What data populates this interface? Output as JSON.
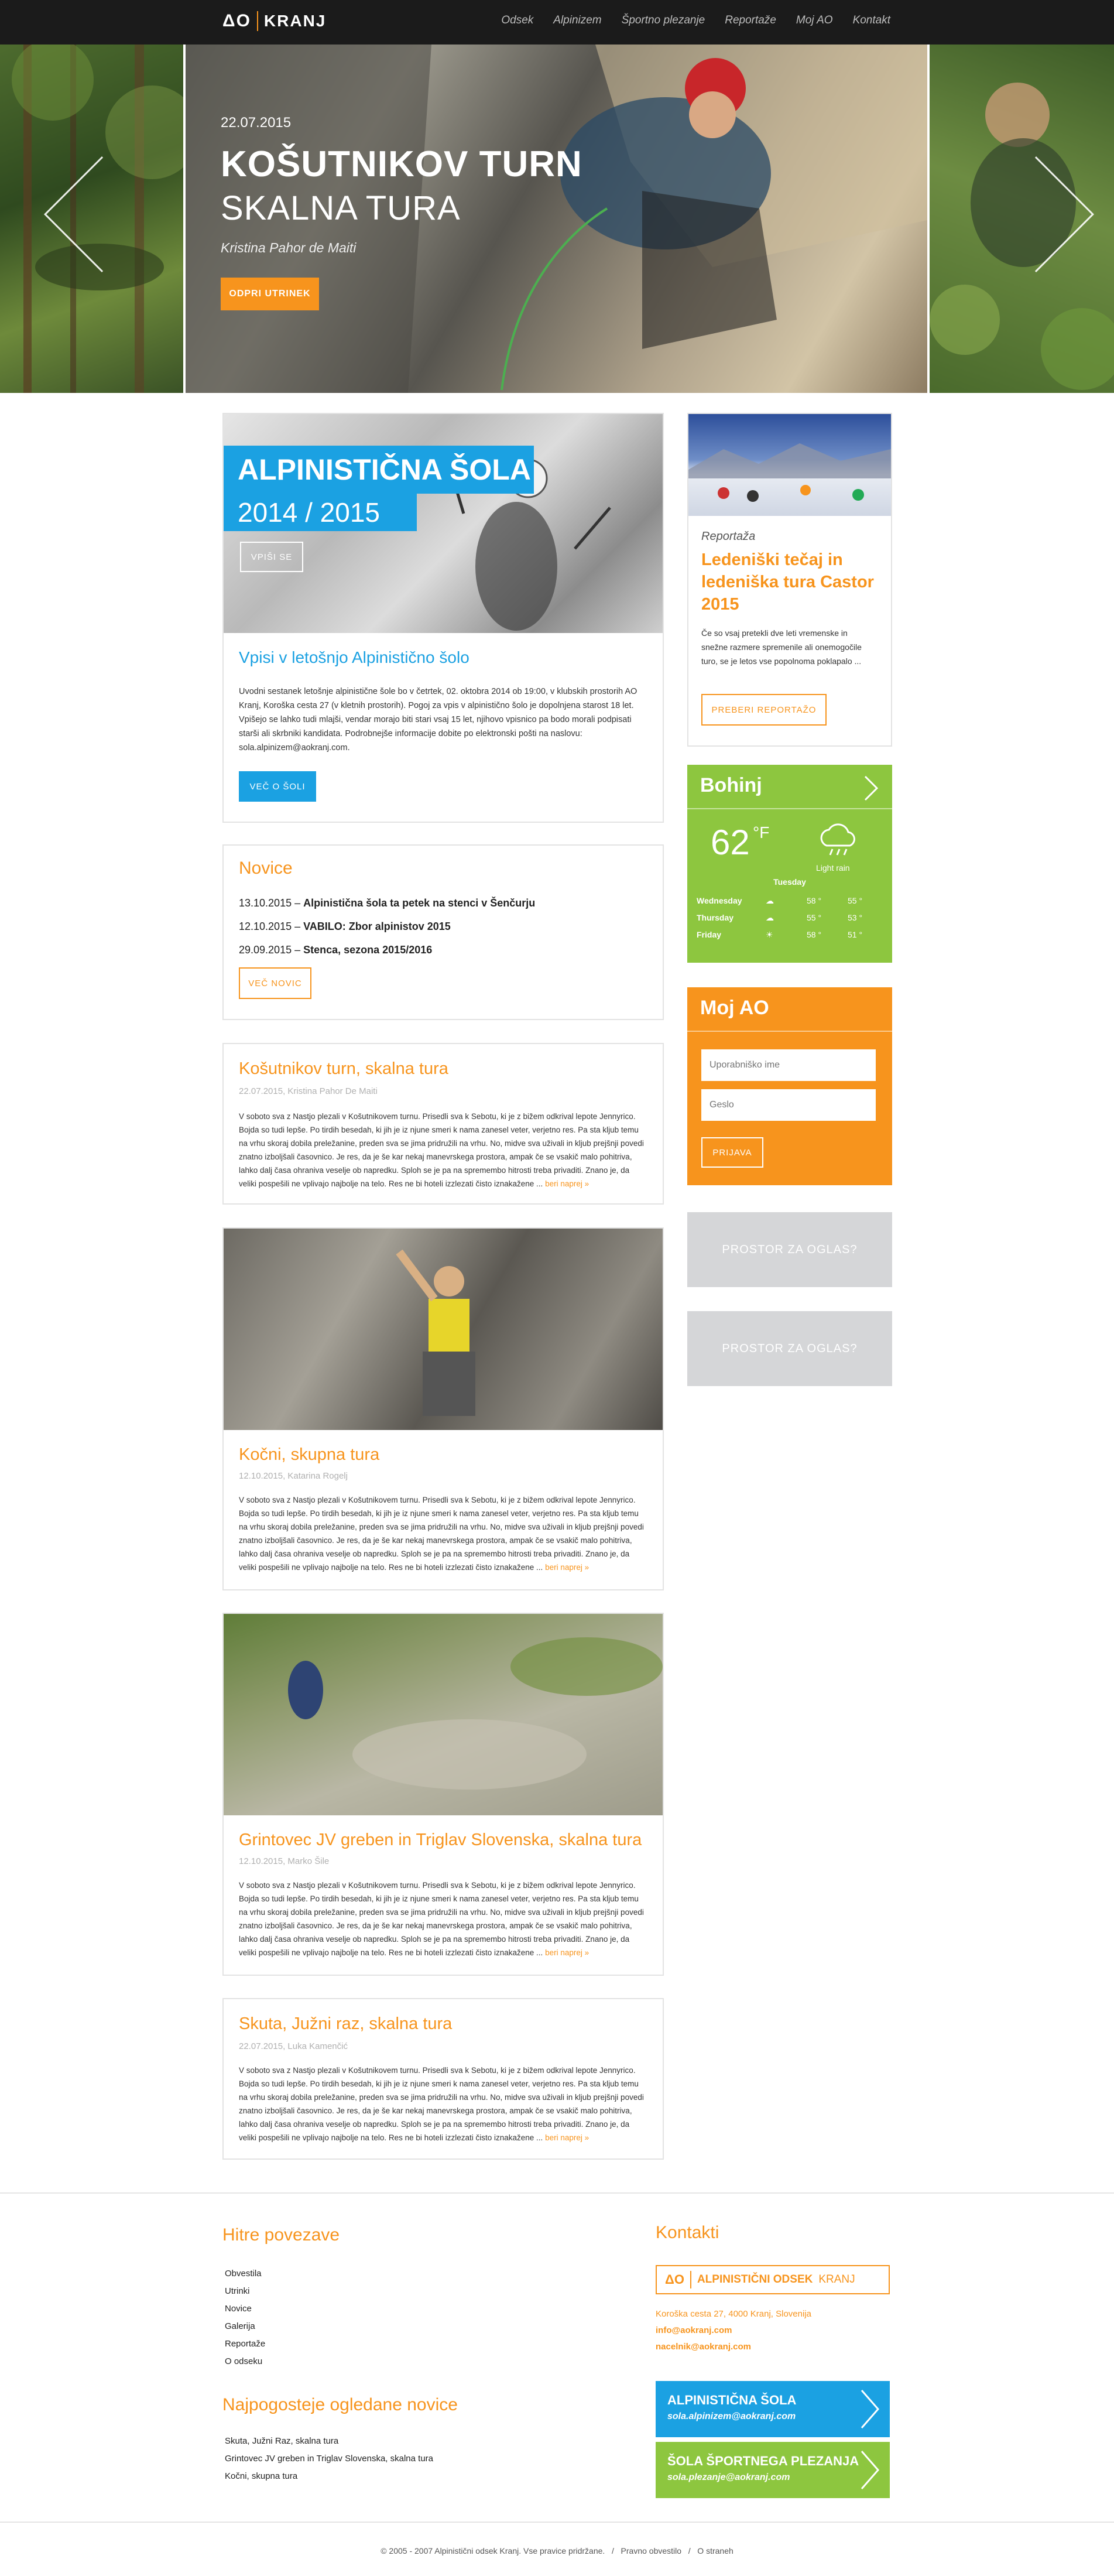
{
  "header": {
    "logo_ao": "ΔO",
    "logo_kranj": "KRANJ",
    "nav": [
      "Odsek",
      "Alpinizem",
      "Športno plezanje",
      "Reportaže",
      "Moj AO",
      "Kontakt"
    ]
  },
  "hero": {
    "date": "22.07.2015",
    "title1": "KOŠUTNIKOV TURN",
    "title2": "SKALNA TURA",
    "author": "Kristina Pahor de Maiti",
    "button": "ODPRI UTRINEK"
  },
  "school": {
    "banner1": "ALPINISTIČNA ŠOLA",
    "banner2": "2014 / 2015",
    "enroll": "VPIŠI SE",
    "title": "Vpisi v letošnjo Alpinistično šolo",
    "body": "Uvodni sestanek letošnje alpinistične šole bo v četrtek, 02. oktobra 2014 ob 19:00, v klubskih prostorih AO Kranj, Koroška cesta 27 (v kletnih prostorih). Pogoj za vpis v alpinistično šolo je dopolnjena starost 18 let. Vpišejo se lahko tudi mlajši, vendar morajo biti stari vsaj 15 let, njihovo vpisnico pa bodo morali podpisati starši ali skrbniki kandidata. Podrobnejše informacije dobite po elektronski pošti na naslovu: sola.alpinizem@aokranj.com.",
    "button": "VEČ O ŠOLI"
  },
  "news": {
    "title": "Novice",
    "items": [
      {
        "date": "13.10.2015",
        "text": "Alpinistična šola ta petek na stenci v Šenčurju"
      },
      {
        "date": "12.10.2015",
        "text": "VABILO: Zbor alpinistov 2015"
      },
      {
        "date": "29.09.2015",
        "text": "Stenca, sezona 2015/2016"
      }
    ],
    "button": "VEČ NOVIC"
  },
  "articles": [
    {
      "title": "Košutnikov turn, skalna tura",
      "meta": "22.07.2015, Kristina Pahor De Maiti",
      "body": "V soboto sva z Nastjo plezali v Košutnikovem turnu. Prisedli sva k Sebotu, ki je z bižem odkrival lepote Jennyrico. Bojda so tudi lepše. Po tirdih besedah, ki jih je iz njune smeri k nama zanesel veter, verjetno res. Pa sta kljub temu na vrhu skoraj dobila preležanine, preden sva se jima pridružili na vrhu. No, midve sva uživali in kljub prejšnji povedi znatno izboljšali časovnico. Je res, da je še kar nekaj manevrskega prostora, ampak če se vsakič malo pohitriva, lahko dalj časa ohraniva veselje ob napredku. Sploh se je pa na spremembo hitrosti treba privaditi. Znano je, da veliki pospešili ne vplivajo najbolje na telo. Res ne bi hoteli izzlezati čisto iznakažene ...",
      "more": "beri naprej »"
    },
    {
      "title": "Kočni, skupna tura",
      "meta": "12.10.2015, Katarina Rogelj",
      "body": "V soboto sva z Nastjo plezali v Košutnikovem turnu. Prisedli sva k Sebotu, ki je z bižem odkrival lepote Jennyrico. Bojda so tudi lepše. Po tirdih besedah, ki jih je iz njune smeri k nama zanesel veter, verjetno res. Pa sta kljub temu na vrhu skoraj dobila preležanine, preden sva se jima pridružili na vrhu. No, midve sva uživali in kljub prejšnji povedi znatno izboljšali časovnico. Je res, da je še kar nekaj manevrskega prostora, ampak če se vsakič malo pohitriva, lahko dalj časa ohraniva veselje ob napredku. Sploh se je pa na spremembo hitrosti treba privaditi. Znano je, da veliki pospešili ne vplivajo najbolje na telo. Res ne bi hoteli izzlezati čisto iznakažene ...",
      "more": "beri naprej »"
    },
    {
      "title": "Grintovec JV greben in Triglav Slovenska, skalna tura",
      "meta": "12.10.2015, Marko Šile",
      "body": "V soboto sva z Nastjo plezali v Košutnikovem turnu. Prisedli sva k Sebotu, ki je z bižem odkrival lepote Jennyrico. Bojda so tudi lepše. Po tirdih besedah, ki jih je iz njune smeri k nama zanesel veter, verjetno res. Pa sta kljub temu na vrhu skoraj dobila preležanine, preden sva se jima pridružili na vrhu. No, midve sva uživali in kljub prejšnji povedi znatno izboljšali časovnico. Je res, da je še kar nekaj manevrskega prostora, ampak če se vsakič malo pohitriva, lahko dalj časa ohraniva veselje ob napredku. Sploh se je pa na spremembo hitrosti treba privaditi. Znano je, da veliki pospešili ne vplivajo najbolje na telo. Res ne bi hoteli izzlezati čisto iznakažene ...",
      "more": "beri naprej »"
    },
    {
      "title": "Skuta, Južni raz, skalna tura",
      "meta": "22.07.2015, Luka Kamenčić",
      "body": "V soboto sva z Nastjo plezali v Košutnikovem turnu. Prisedli sva k Sebotu, ki je z bižem odkrival lepote Jennyrico. Bojda so tudi lepše. Po tirdih besedah, ki jih je iz njune smeri k nama zanesel veter, verjetno res. Pa sta kljub temu na vrhu skoraj dobila preležanine, preden sva se jima pridružili na vrhu. No, midve sva uživali in kljub prejšnji povedi znatno izboljšali časovnico. Je res, da je še kar nekaj manevrskega prostora, ampak če se vsakič malo pohitriva, lahko dalj časa ohraniva veselje ob napredku. Sploh se je pa na spremembo hitrosti treba privaditi. Znano je, da veliki pospešili ne vplivajo najbolje na telo. Res ne bi hoteli izzlezati čisto iznakažene ...",
      "more": "beri naprej »"
    }
  ],
  "report": {
    "label": "Reportaža",
    "title": "Ledeniški tečaj in ledeniška tura Castor 2015",
    "body": "Če so vsaj pretekli dve leti vremenske in snežne razmere spremenile ali onemogočile turo, se je letos vse popolnoma poklapalo ...",
    "button": "PREBERI REPORTAŽO"
  },
  "weather": {
    "place": "Bohinj",
    "temp": "62",
    "unit": "°F",
    "cond": "Light rain",
    "today": "Tuesday",
    "days": [
      {
        "name": "Wednesday",
        "hi": "58 °",
        "lo": "55 °"
      },
      {
        "name": "Thursday",
        "hi": "55 °",
        "lo": "53 °"
      },
      {
        "name": "Friday",
        "hi": "58 °",
        "lo": "51 °"
      }
    ]
  },
  "login": {
    "title": "Moj AO",
    "user_placeholder": "Uporabniško ime",
    "pass_placeholder": "Geslo",
    "button": "PRIJAVA"
  },
  "ads": [
    "PROSTOR ZA OGLAS?",
    "PROSTOR ZA OGLAS?"
  ],
  "footer": {
    "links_title": "Hitre povezave",
    "links": [
      "Obvestila",
      "Utrinki",
      "Novice",
      "Galerija",
      "Reportaže",
      "O odseku"
    ],
    "popular_title": "Najpogosteje ogledane novice",
    "popular": [
      "Skuta, Južni Raz, skalna tura",
      "Grintovec JV greben in Triglav Slovenska, skalna tura",
      "Kočni, skupna tura"
    ],
    "contact_title": "Kontakti",
    "contact_logo_ao": "ΔO",
    "contact_logo_name": "ALPINISTIČNI ODSEK",
    "contact_logo_kranj": "KRANJ",
    "address": "Koroška cesta 27, 4000 Kranj, Slovenija",
    "email1": "info@aokranj.com",
    "email2": "nacelnik@aokranj.com",
    "school_title": "ALPINISTIČNA ŠOLA",
    "school_email": "sola.alpinizem@aokranj.com",
    "climb_title": "ŠOLA ŠPORTNEGA PLEZANJA",
    "climb_email": "sola.plezanje@aokranj.com",
    "copyright": "© 2005 - 2007 Alpinistični odsek Kranj. Vse pravice pridržane.",
    "legal1": "Pravno obvestilo",
    "legal2": "O straneh",
    "slash": "/"
  }
}
